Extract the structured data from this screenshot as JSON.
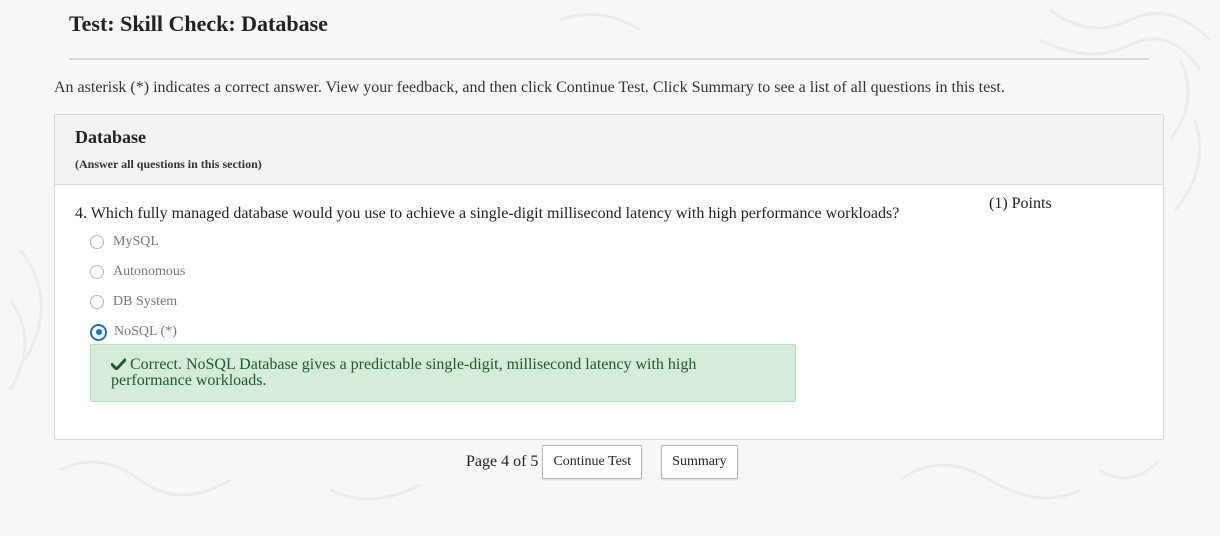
{
  "page": {
    "title": "Test: Skill Check: Database",
    "instructions": "An asterisk (*) indicates a correct answer. View your feedback, and then click Continue Test. Click Summary to see a list of all questions in this test."
  },
  "section": {
    "title": "Database",
    "subtitle": "(Answer all questions in this section)"
  },
  "question": {
    "text": "4. Which fully managed database would you use to achieve a single-digit millisecond latency with high performance workloads?",
    "points": "(1) Points",
    "options": [
      {
        "label": "MySQL",
        "selected": false
      },
      {
        "label": "Autonomous",
        "selected": false
      },
      {
        "label": "DB System",
        "selected": false
      },
      {
        "label": "NoSQL (*)",
        "selected": true
      }
    ],
    "feedback": "Correct. NoSQL Database gives a predictable single-digit, millisecond latency with high performance workloads."
  },
  "pager": {
    "page_label": "Page 4 of 5",
    "continue_label": "Continue Test",
    "summary_label": "Summary"
  },
  "colors": {
    "accent": "#1a73c8",
    "feedback_bg": "#d4ecd9",
    "feedback_text": "#1e5a2a"
  },
  "icons": {
    "radio_selected": "radio-selected-icon",
    "radio_unselected": "radio-unselected-icon",
    "feedback": "check-icon"
  }
}
